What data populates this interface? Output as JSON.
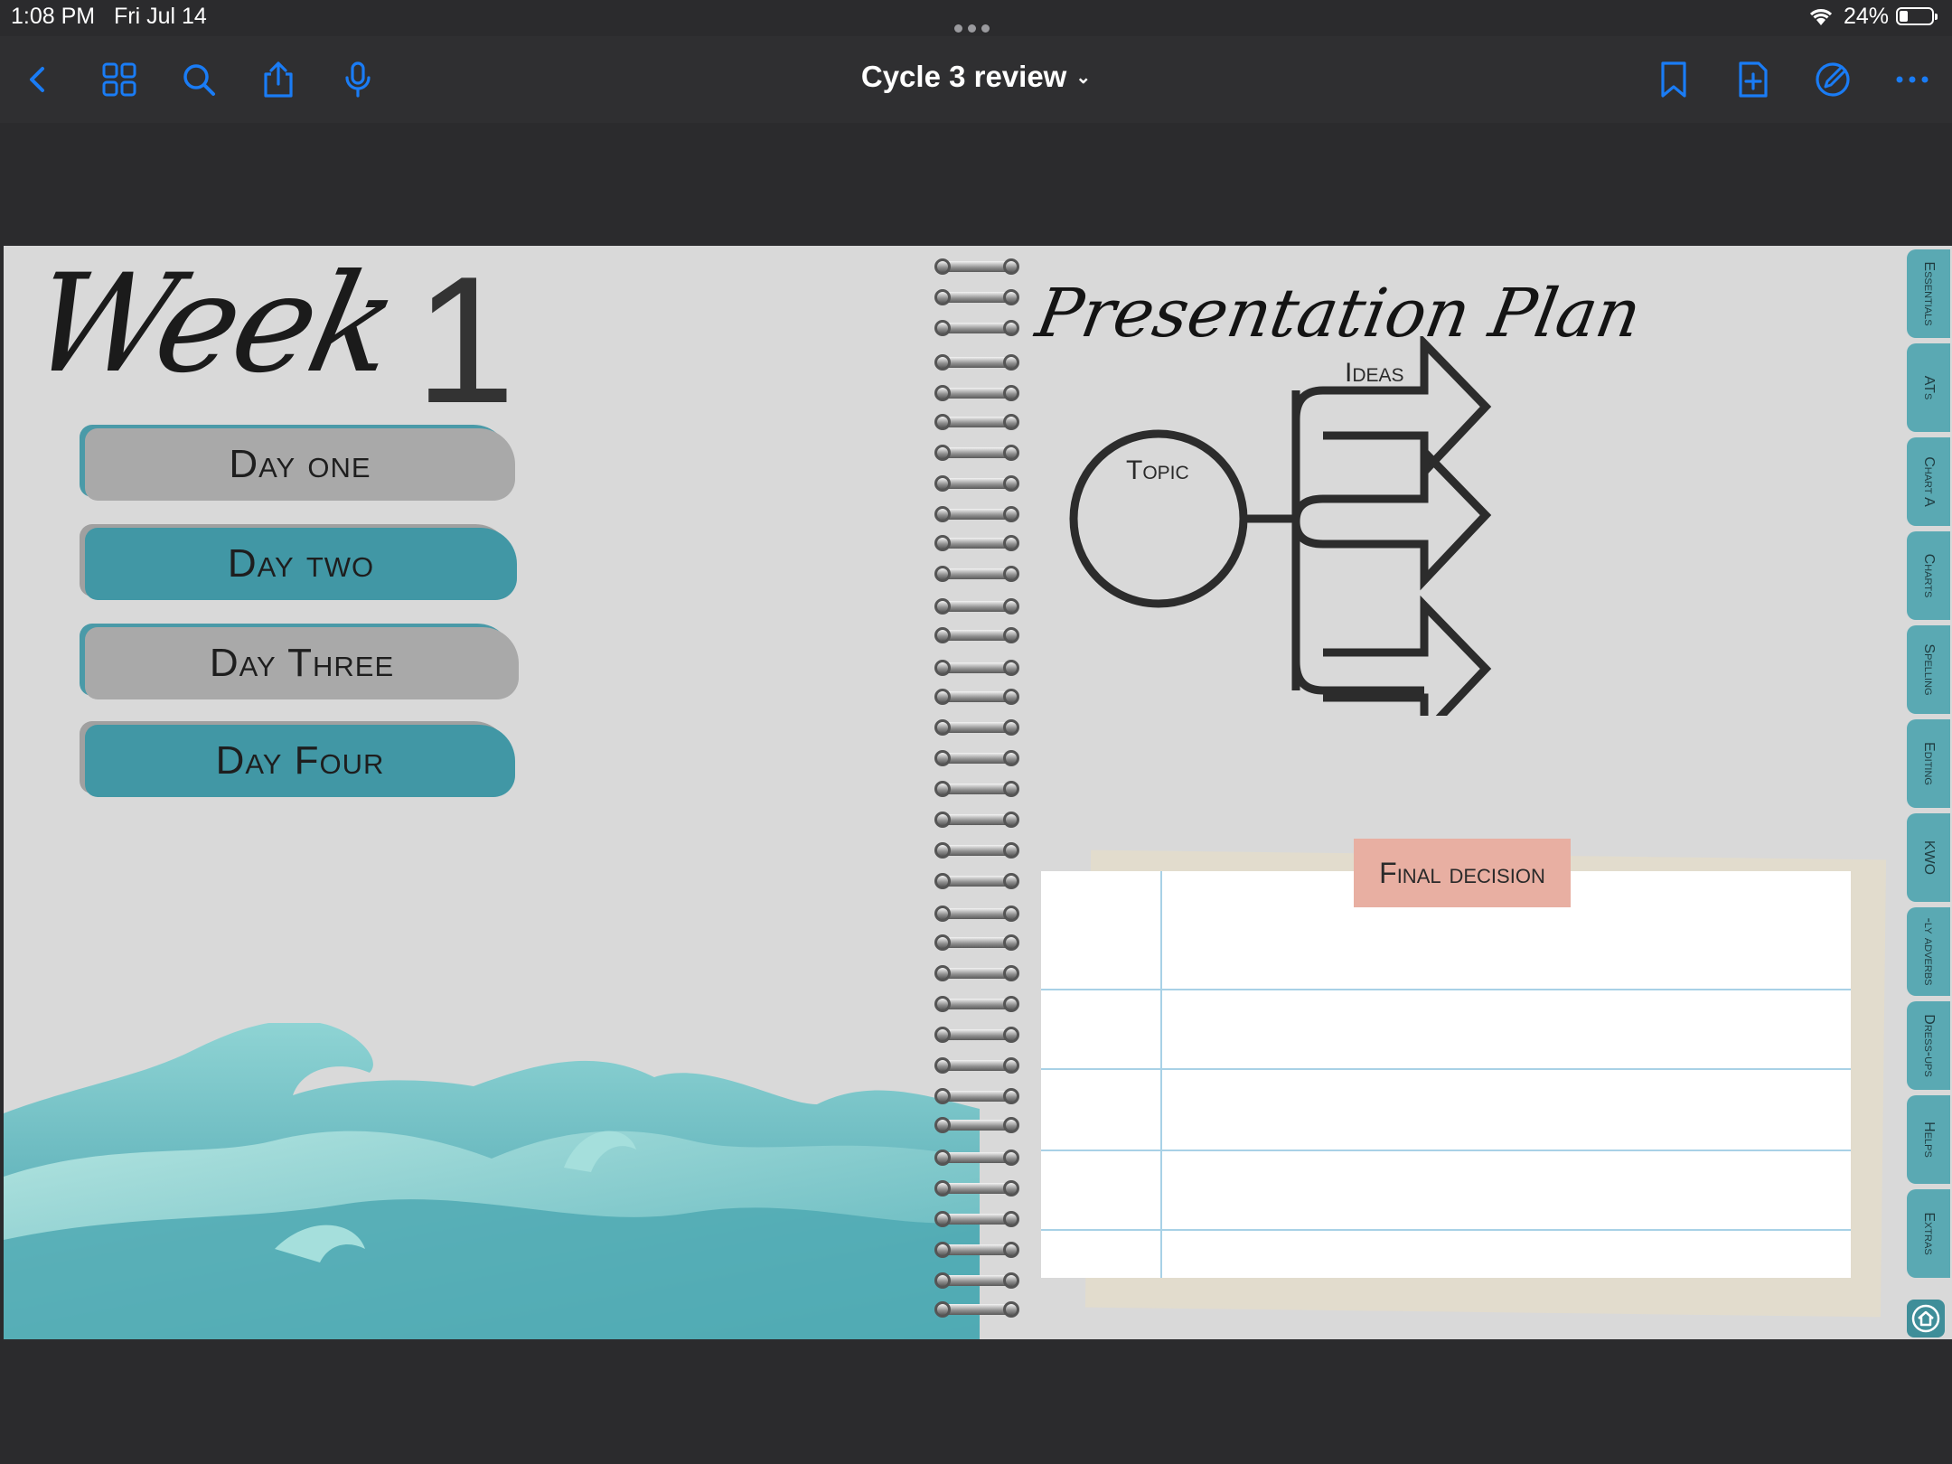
{
  "status_bar": {
    "time": "1:08 PM",
    "date": "Fri Jul 14",
    "battery_percent": "24%",
    "battery_level": 0.24
  },
  "toolbar": {
    "document_title": "Cycle 3 review",
    "left_icons": [
      "back-icon",
      "grid-icon",
      "search-icon",
      "share-icon",
      "microphone-icon"
    ],
    "right_icons": [
      "bookmark-icon",
      "add-page-icon",
      "pencil-circle-icon",
      "more-icon"
    ],
    "accent_color": "#1a7cf5"
  },
  "left_page": {
    "title": "Week",
    "week_number": "1",
    "days": [
      {
        "label": "Day one",
        "color": "#a9a9a9"
      },
      {
        "label": "Day two",
        "color": "#4197a5"
      },
      {
        "label": "Day Three",
        "color": "#a9a9a9"
      },
      {
        "label": "Day Four",
        "color": "#4197a5"
      }
    ]
  },
  "right_page": {
    "title": "Presentation Plan",
    "topic_label": "Topic",
    "ideas_label": "Ideas",
    "final_decision_label": "Final decision"
  },
  "side_tabs": [
    "Essentials",
    "ATs",
    "Chart A",
    "Charts",
    "Spelling",
    "Editing",
    "KWO",
    "-ly adverbs",
    "Dress-ups",
    "Helps",
    "Extras"
  ],
  "colors": {
    "teal": "#4197a5",
    "tab_teal": "#5aa9b3",
    "tape_pink": "#e8afa2",
    "page_bg": "#d9d9d9"
  }
}
